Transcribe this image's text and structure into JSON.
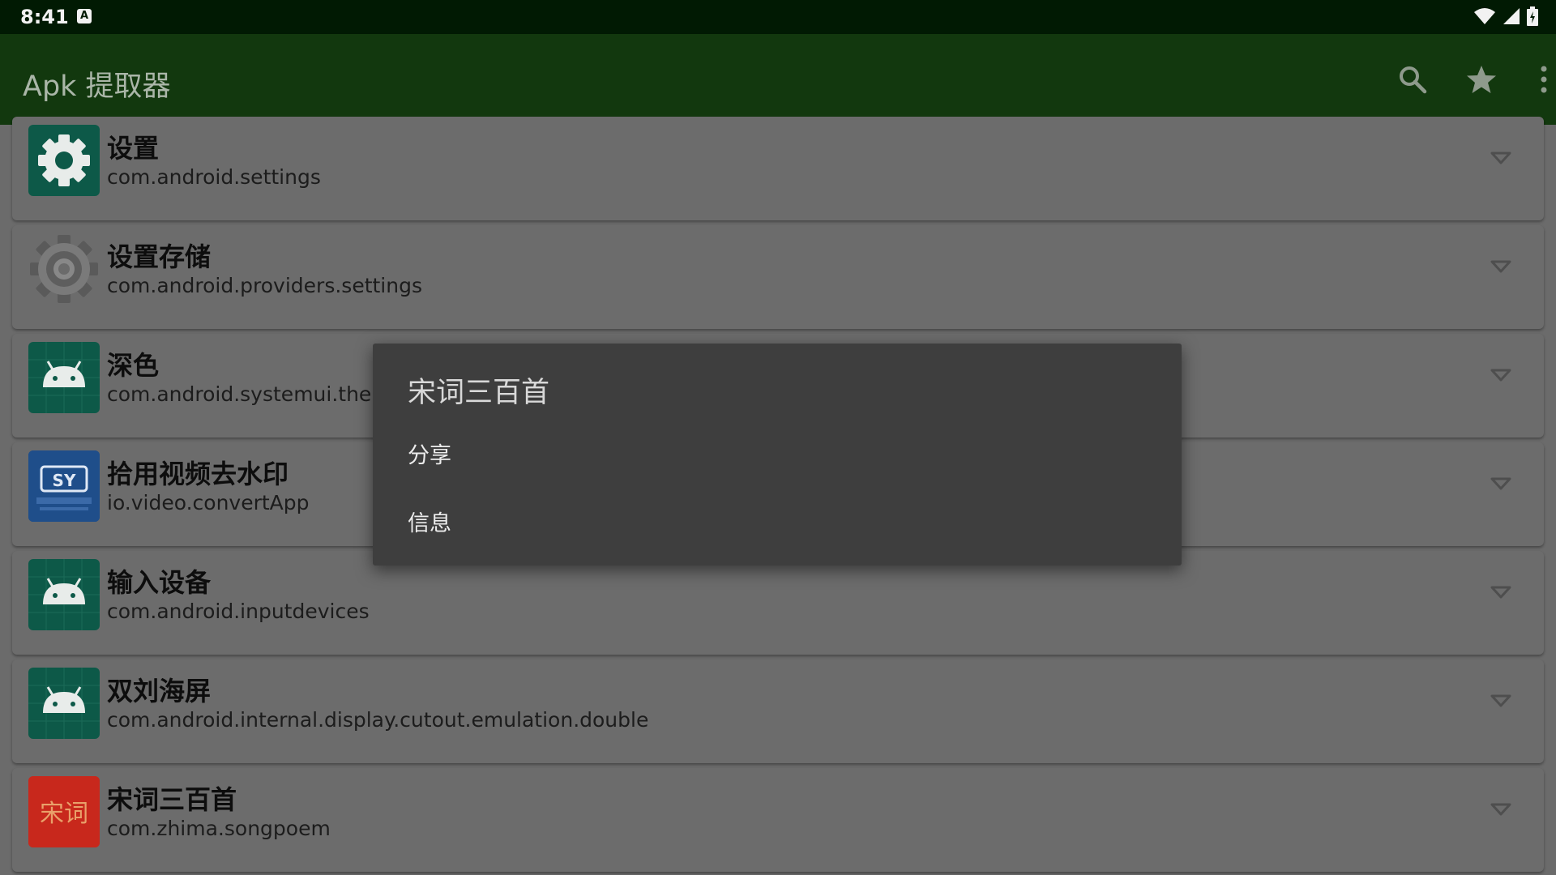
{
  "status_bar": {
    "time": "8:41",
    "notification_icon": "A",
    "icons": [
      "wifi-icon",
      "signal-icon",
      "battery-icon"
    ]
  },
  "app_bar": {
    "title": "Apk 提取器",
    "actions": [
      "search-icon",
      "star-icon",
      "more-vert-icon"
    ],
    "color": "#12380e"
  },
  "apps": [
    {
      "name": "设置",
      "package": "com.android.settings",
      "icon": "settings-gear-icon"
    },
    {
      "name": "设置存储",
      "package": "com.android.providers.settings",
      "icon": "gray-gear-icon"
    },
    {
      "name": "深色",
      "package": "com.android.systemui.theme.",
      "icon": "android-icon"
    },
    {
      "name": "拾用视频去水印",
      "package": "io.video.convertApp",
      "icon": "video-watermark-icon",
      "icon_text": "SY"
    },
    {
      "name": "输入设备",
      "package": "com.android.inputdevices",
      "icon": "android-icon"
    },
    {
      "name": "双刘海屏",
      "package": "com.android.internal.display.cutout.emulation.double",
      "icon": "android-icon"
    },
    {
      "name": "宋词三百首",
      "package": "com.zhima.songpoem",
      "icon": "songci-icon",
      "icon_text": "宋词"
    }
  ],
  "dialog": {
    "title": "宋词三百首",
    "items": [
      "分享",
      "信息"
    ]
  },
  "colors": {
    "android_icon_bg": "#0d5948",
    "songci_icon_bg": "#c8281c",
    "video_icon_bg": "#1f4e8a"
  }
}
